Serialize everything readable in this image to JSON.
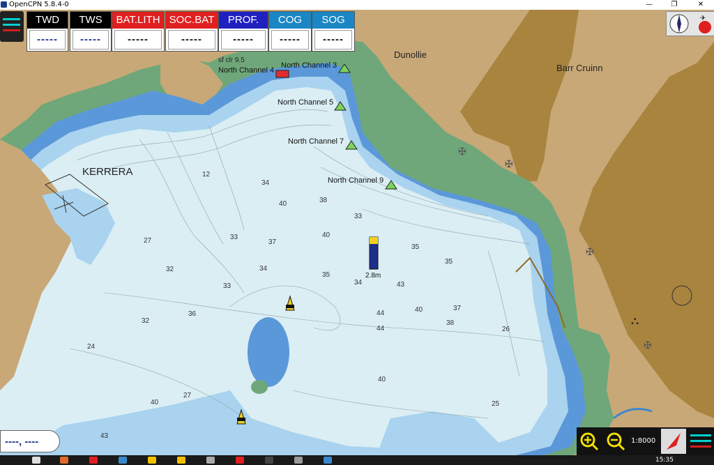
{
  "window": {
    "title": "OpenCPN 5.8.4-0"
  },
  "instruments": [
    {
      "label": "TWD",
      "value": "-----",
      "color": "#000000"
    },
    {
      "label": "TWS",
      "value": "-----",
      "color": "#000000"
    },
    {
      "label": "BAT.LITH",
      "value": "-----",
      "color": "#e02020"
    },
    {
      "label": "SOC.BAT",
      "value": "-----",
      "color": "#e02020"
    },
    {
      "label": "PROF.",
      "value": "-----",
      "color": "#2020c0"
    },
    {
      "label": "COG",
      "value": "-----",
      "color": "#1a86c4"
    },
    {
      "label": "SOG",
      "value": "-----",
      "color": "#1a86c4"
    }
  ],
  "map": {
    "places": [
      "Dunollie",
      "Barr Cruinn",
      "KERRERA"
    ],
    "channels": [
      "North Channel 3",
      "North Channel 4",
      "North Channel 5",
      "North Channel 7",
      "North Channel 9"
    ],
    "light_label": "sf clr  9.5",
    "tide_label": "2.8m"
  },
  "status": {
    "cursor": "----, ----",
    "scale": "1:8000"
  },
  "taskbar": {
    "clock": "15:35"
  },
  "colors": {
    "deep_water": "#dbeef4",
    "shallow": "#a9d3ee",
    "very_shallow": "#5b98d9",
    "land": "#c9a877",
    "green_intertidal": "#6fa77a",
    "dark_land": "#a8843f"
  }
}
